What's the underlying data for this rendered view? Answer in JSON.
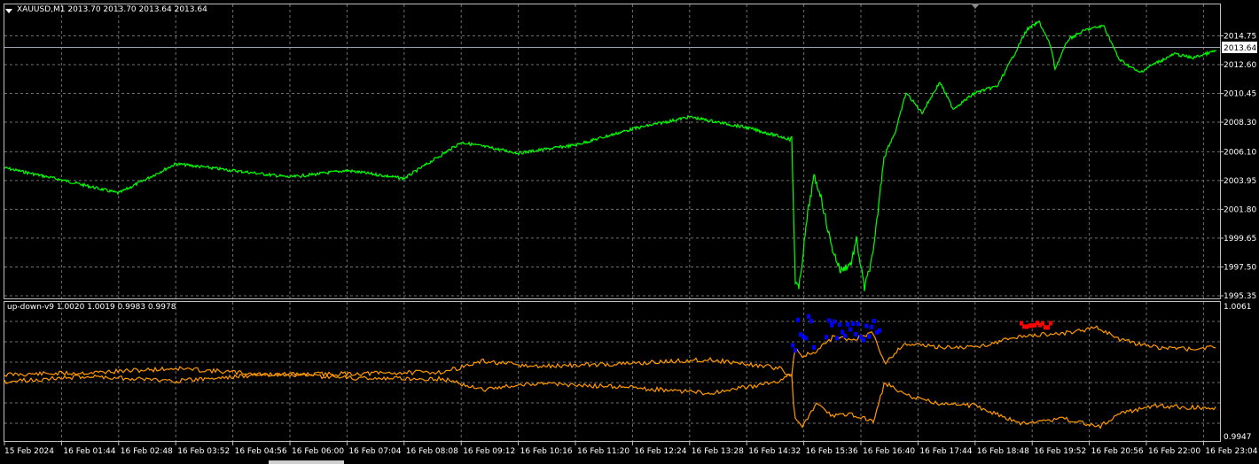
{
  "window": {
    "symbol_title": "XAUUSD,M1  2013.70 2013.70 2013.64 2013.64"
  },
  "main_chart": {
    "price_axis": [
      "2014.75",
      "2012.60",
      "2010.45",
      "2008.30",
      "2006.10",
      "2003.95",
      "2001.80",
      "1999.65",
      "1997.50",
      "1995.35"
    ],
    "current_price": "2013.64",
    "price_range": [
      1995.35,
      2016.3
    ],
    "series_color": "#00ff00"
  },
  "indicator": {
    "title": "up-down-v9 1.0020 1.0019 0.9983 0.9978",
    "axis_top": "1.0061",
    "axis_bottom": "0.9947",
    "line_color": "#ff9900",
    "up_marker_color": "#0000ff",
    "down_marker_color": "#ff0000"
  },
  "time_axis": [
    "15 Feb 2024",
    "16 Feb 01:44",
    "16 Feb 02:48",
    "16 Feb 03:52",
    "16 Feb 04:56",
    "16 Feb 06:00",
    "16 Feb 07:04",
    "16 Feb 08:08",
    "16 Feb 09:12",
    "16 Feb 10:16",
    "16 Feb 11:20",
    "16 Feb 12:24",
    "16 Feb 13:28",
    "16 Feb 14:32",
    "16 Feb 15:36",
    "16 Feb 16:40",
    "16 Feb 17:44",
    "16 Feb 18:48",
    "16 Feb 19:52",
    "16 Feb 20:56",
    "16 Feb 22:00",
    "16 Feb 23:04"
  ],
  "chart_data": {
    "type": "line",
    "title": "XAUUSD,M1",
    "x": [
      "15 Feb 2024",
      "16 Feb 01:44",
      "16 Feb 02:48",
      "16 Feb 03:52",
      "16 Feb 04:56",
      "16 Feb 06:00",
      "16 Feb 07:04",
      "16 Feb 08:08",
      "16 Feb 09:12",
      "16 Feb 10:16",
      "16 Feb 11:20",
      "16 Feb 12:24",
      "16 Feb 13:28",
      "16 Feb 14:32",
      "16 Feb 15:36",
      "16 Feb 16:40",
      "16 Feb 17:44",
      "16 Feb 18:48",
      "16 Feb 19:52",
      "16 Feb 20:56",
      "16 Feb 22:00",
      "16 Feb 23:04"
    ],
    "ylim": [
      1995.35,
      2016.3
    ],
    "grid": true,
    "series": [
      {
        "values": [
          2004.9,
          2004.0,
          2003.0,
          2005.2,
          2004.7,
          2004.2,
          2004.7,
          2004.1,
          2006.8,
          2006.0,
          2006.6,
          2007.8,
          2008.7,
          2007.9,
          2001.0,
          2003.5,
          2010.4,
          2011.0,
          2014.2,
          2015.1,
          2012.6,
          2013.64
        ]
      }
    ]
  }
}
